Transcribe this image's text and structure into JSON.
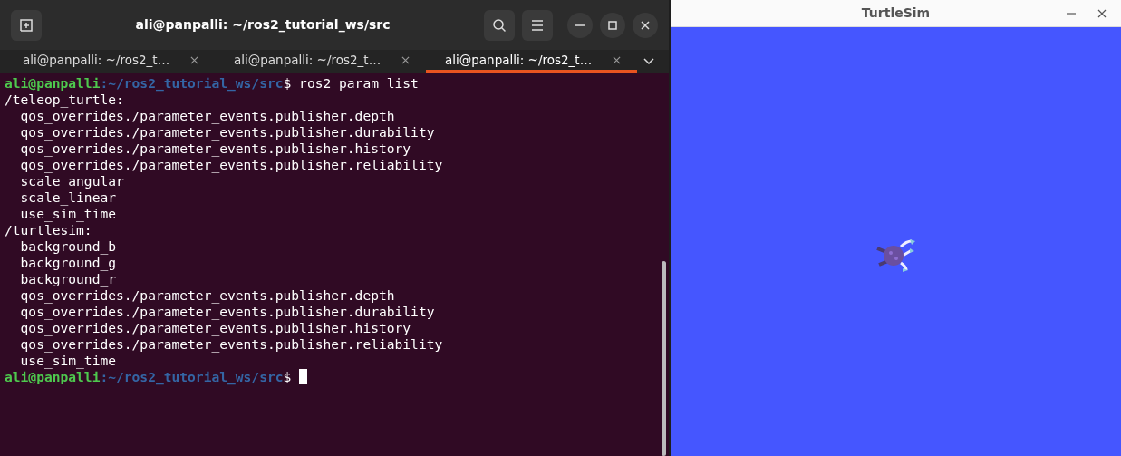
{
  "terminal": {
    "title": "ali@panpalli: ~/ros2_tutorial_ws/src",
    "tabs": [
      {
        "label": "ali@panpalli: ~/ros2_t…",
        "selected": false
      },
      {
        "label": "ali@panpalli: ~/ros2_t…",
        "selected": false
      },
      {
        "label": "ali@panpalli: ~/ros2_t…",
        "selected": true
      }
    ],
    "lines": [
      {
        "kind": "prompt",
        "user": "ali@panpalli",
        "path": ":~/ros2_tutorial_ws/src",
        "command": "$ ros2 param list"
      },
      {
        "kind": "output",
        "text": "/teleop_turtle:"
      },
      {
        "kind": "output",
        "text": "  qos_overrides./parameter_events.publisher.depth"
      },
      {
        "kind": "output",
        "text": "  qos_overrides./parameter_events.publisher.durability"
      },
      {
        "kind": "output",
        "text": "  qos_overrides./parameter_events.publisher.history"
      },
      {
        "kind": "output",
        "text": "  qos_overrides./parameter_events.publisher.reliability"
      },
      {
        "kind": "output",
        "text": "  scale_angular"
      },
      {
        "kind": "output",
        "text": "  scale_linear"
      },
      {
        "kind": "output",
        "text": "  use_sim_time"
      },
      {
        "kind": "output",
        "text": "/turtlesim:"
      },
      {
        "kind": "output",
        "text": "  background_b"
      },
      {
        "kind": "output",
        "text": "  background_g"
      },
      {
        "kind": "output",
        "text": "  background_r"
      },
      {
        "kind": "output",
        "text": "  qos_overrides./parameter_events.publisher.depth"
      },
      {
        "kind": "output",
        "text": "  qos_overrides./parameter_events.publisher.durability"
      },
      {
        "kind": "output",
        "text": "  qos_overrides./parameter_events.publisher.history"
      },
      {
        "kind": "output",
        "text": "  qos_overrides./parameter_events.publisher.reliability"
      },
      {
        "kind": "output",
        "text": "  use_sim_time"
      },
      {
        "kind": "prompt",
        "user": "ali@panpalli",
        "path": ":~/ros2_tutorial_ws/src",
        "command": "$ ",
        "cursor": true
      }
    ]
  },
  "turtlesim": {
    "title": "TurtleSim"
  }
}
